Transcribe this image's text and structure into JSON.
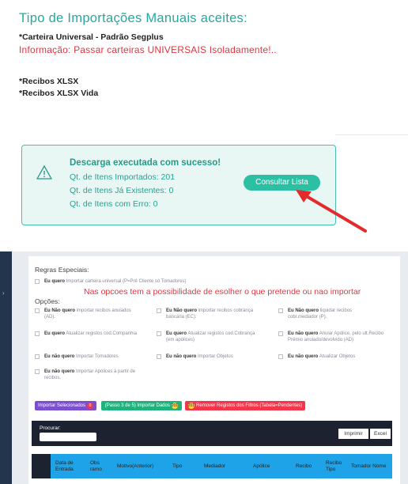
{
  "top": {
    "title": "Tipo de Importações Manuais aceites:",
    "line1": "*Carteira Universal - Padrão Segplus",
    "red_info": "Informação: Passar carteiras UNIVERSAIS Isoladamente!..",
    "line2": "*Recibos XLSX",
    "line3": "*Recibos XLSX Vida"
  },
  "alert": {
    "title": "Descarga executada com sucesso!",
    "imported": "Qt. de Itens Importados: 201",
    "existing": "Qt. de Itens Já Existentes: 0",
    "errors": "Qt. de Itens com Erro: 0",
    "button": "Consultar Lista",
    "icon": "warning-triangle-icon"
  },
  "colors": {
    "teal": "#2bc0a3",
    "red": "#e6343f",
    "purple": "#7b4fcf",
    "green": "#21b17d",
    "pink": "#f4364c",
    "table_header": "#1fa3e8"
  },
  "options": {
    "regras_label": "Regras Especiais:",
    "regra_universal": {
      "bold": "Eu quero",
      "text": "Importar carteira universal (P=Pré Cliente só Tomadores)"
    },
    "note": "Nas opcoes tem a possibilidade de esolher o que pretende ou nao importar",
    "opcoes_label": "Opções:",
    "items": [
      {
        "bold": "Eu Não quero",
        "text": "importar recibos anulados (AD)."
      },
      {
        "bold": "Eu Não quero",
        "text": "importar recibos cobrança bancária (EC)."
      },
      {
        "bold": "Eu Não quero",
        "text": "liquidar recibos cobr.mediador (P)."
      },
      {
        "bold": "Eu quero",
        "text": "Atualizar registos cod.Companhia"
      },
      {
        "bold": "Eu quero",
        "text": "Atualizar registos cod.Cobrança (em apólices)"
      },
      {
        "bold": "Eu não quero",
        "text": "Anular Apólice, pelo ult.Recibo Prémio anulado/devolvido (AD)"
      },
      {
        "bold": "Eu não quero",
        "text": "Importar Tomadores"
      },
      {
        "bold": "Eu não quero",
        "text": "Importar Objetos"
      },
      {
        "bold": "Eu não quero",
        "text": "Atualizar Objetos"
      },
      {
        "bold": "Eu não quero",
        "text": "Importar Apólices à partir de recibos."
      }
    ]
  },
  "actions": {
    "import_selected": "Importar Selecionados",
    "import_selected_count": "0",
    "import_data": "(Passo 3 de 5) Importar Dados",
    "import_data_count": "201",
    "remove_filters": "Remover Registos dos Filtros (Tabela=Pendentes)",
    "remove_filters_count": "201"
  },
  "table": {
    "search_label": "Procurar:",
    "print": "Imprimir",
    "excel": "Excel",
    "columns": [
      "Data de Entrada",
      "Obs ramo",
      "Motivo(Anterior)",
      "Tipo",
      "Mediador",
      "Apólice",
      "Recibo",
      "Recibo Tipo",
      "Tomador Nome"
    ]
  }
}
